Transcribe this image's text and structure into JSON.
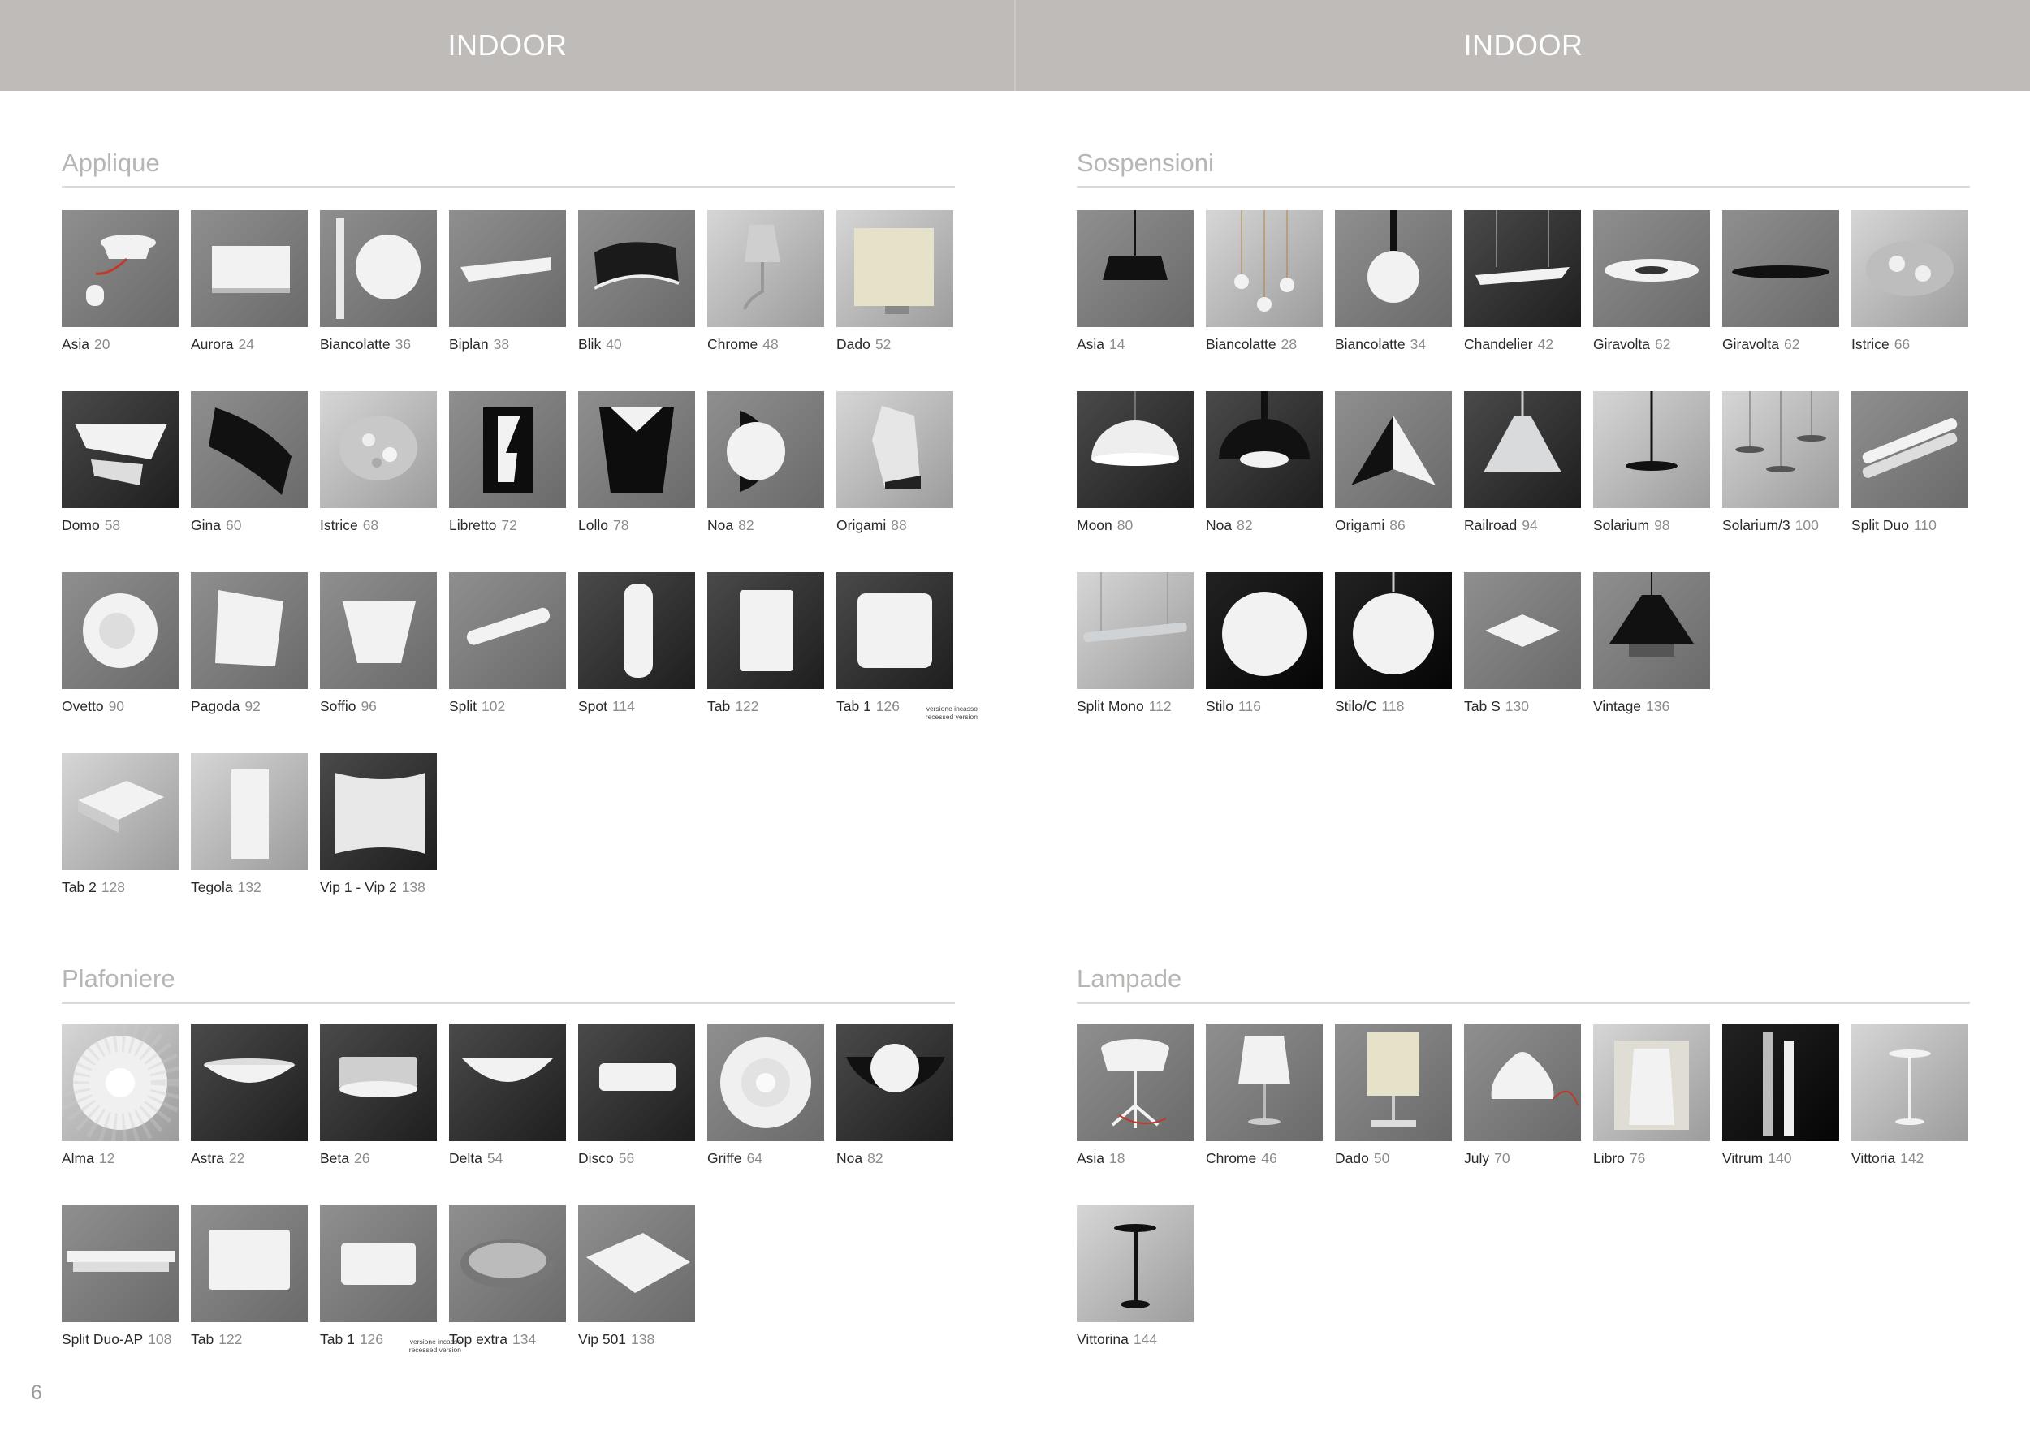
{
  "header": {
    "left_title": "INDOOR",
    "right_title": "INDOOR"
  },
  "page_number": "6",
  "sections": {
    "applique": {
      "title": "Applique",
      "items": [
        {
          "name": "Asia",
          "page": "20",
          "icon": "wall-lamp-red-arm"
        },
        {
          "name": "Aurora",
          "page": "24",
          "icon": "wall-panel-black"
        },
        {
          "name": "Biancolatte",
          "page": "36",
          "icon": "wall-globe"
        },
        {
          "name": "Biplan",
          "page": "38",
          "icon": "wall-bar"
        },
        {
          "name": "Blik",
          "page": "40",
          "icon": "wall-wave-black"
        },
        {
          "name": "Chrome",
          "page": "48",
          "icon": "wall-chrome-shade"
        },
        {
          "name": "Dado",
          "page": "52",
          "icon": "wall-fabric-cube"
        },
        {
          "name": "Domo",
          "page": "58",
          "icon": "wall-dome-box"
        },
        {
          "name": "Gina",
          "page": "60",
          "icon": "wall-black-fold"
        },
        {
          "name": "Istrice",
          "page": "68",
          "icon": "wall-crystal"
        },
        {
          "name": "Libretto",
          "page": "72",
          "icon": "wall-book-black"
        },
        {
          "name": "Lollo",
          "page": "78",
          "icon": "wall-cone-black"
        },
        {
          "name": "Noa",
          "page": "82",
          "icon": "wall-half-bowl"
        },
        {
          "name": "Origami",
          "page": "88",
          "icon": "wall-origami"
        },
        {
          "name": "Ovetto",
          "page": "90",
          "icon": "wall-round-shell"
        },
        {
          "name": "Pagoda",
          "page": "92",
          "icon": "wall-pagoda"
        },
        {
          "name": "Soffio",
          "page": "96",
          "icon": "wall-cone-white"
        },
        {
          "name": "Split",
          "page": "102",
          "icon": "wall-tube"
        },
        {
          "name": "Spot",
          "page": "114",
          "icon": "wall-cylinder"
        },
        {
          "name": "Tab",
          "page": "122",
          "icon": "wall-square-tall"
        },
        {
          "name": "Tab 1",
          "page": "126",
          "icon": "wall-recessed-square",
          "note_it": "versione incasso",
          "note_en": "recessed version"
        },
        {
          "name": "Tab 2",
          "page": "128",
          "icon": "wall-square-box"
        },
        {
          "name": "Tegola",
          "page": "132",
          "icon": "wall-tile"
        },
        {
          "name": "Vip 1 - Vip 2",
          "page": "138",
          "icon": "wall-curved-panel"
        }
      ]
    },
    "sospensioni": {
      "title": "Sospensioni",
      "items": [
        {
          "name": "Asia",
          "page": "14",
          "icon": "pendant-drum-black"
        },
        {
          "name": "Biancolatte",
          "page": "28",
          "icon": "pendant-multi-globes"
        },
        {
          "name": "Biancolatte",
          "page": "34",
          "icon": "pendant-globe"
        },
        {
          "name": "Chandelier",
          "page": "42",
          "icon": "pendant-chandelier"
        },
        {
          "name": "Giravolta",
          "page": "62",
          "icon": "pendant-ring"
        },
        {
          "name": "Giravolta",
          "page": "62",
          "icon": "pendant-disc"
        },
        {
          "name": "Istrice",
          "page": "66",
          "icon": "pendant-crystal"
        },
        {
          "name": "Moon",
          "page": "80",
          "icon": "pendant-dome-white"
        },
        {
          "name": "Noa",
          "page": "82",
          "icon": "pendant-dome-black"
        },
        {
          "name": "Origami",
          "page": "86",
          "icon": "pendant-origami"
        },
        {
          "name": "Railroad",
          "page": "94",
          "icon": "pendant-railroad"
        },
        {
          "name": "Solarium",
          "page": "98",
          "icon": "pendant-solarium"
        },
        {
          "name": "Solarium/3",
          "page": "100",
          "icon": "pendant-solarium-three"
        },
        {
          "name": "Split Duo",
          "page": "110",
          "icon": "pendant-double-tube"
        },
        {
          "name": "Split Mono",
          "page": "112",
          "icon": "pendant-single-tube"
        },
        {
          "name": "Stilo",
          "page": "116",
          "icon": "pendant-globe-large"
        },
        {
          "name": "Stilo/C",
          "page": "118",
          "icon": "pendant-globe-chain"
        },
        {
          "name": "Tab S",
          "page": "130",
          "icon": "pendant-square"
        },
        {
          "name": "Vintage",
          "page": "136",
          "icon": "pendant-cage-black"
        }
      ]
    },
    "plafoniere": {
      "title": "Plafoniere",
      "items": [
        {
          "name": "Alma",
          "page": "12",
          "icon": "ceiling-petals"
        },
        {
          "name": "Astra",
          "page": "22",
          "icon": "ceiling-dome-dark"
        },
        {
          "name": "Beta",
          "page": "26",
          "icon": "ceiling-drum-chrome"
        },
        {
          "name": "Delta",
          "page": "54",
          "icon": "ceiling-bowl-dark"
        },
        {
          "name": "Disco",
          "page": "56",
          "icon": "ceiling-disc"
        },
        {
          "name": "Griffe",
          "page": "64",
          "icon": "ceiling-swirl"
        },
        {
          "name": "Noa",
          "page": "82",
          "icon": "ceiling-half-bowl"
        },
        {
          "name": "Split Duo-AP",
          "page": "108",
          "icon": "ceiling-double-bar"
        },
        {
          "name": "Tab",
          "page": "122",
          "icon": "ceiling-square"
        },
        {
          "name": "Tab 1",
          "page": "126",
          "icon": "ceiling-square-flat",
          "note_it": "versione incasso",
          "note_en": "recessed version"
        },
        {
          "name": "Top extra",
          "page": "134",
          "icon": "ceiling-round-grey"
        },
        {
          "name": "Vip 501",
          "page": "138",
          "icon": "ceiling-curved-square"
        }
      ]
    },
    "lampade": {
      "title": "Lampade",
      "items": [
        {
          "name": "Asia",
          "page": "18",
          "icon": "table-tripod"
        },
        {
          "name": "Chrome",
          "page": "46",
          "icon": "table-shade-chrome"
        },
        {
          "name": "Dado",
          "page": "50",
          "icon": "table-fabric-cube"
        },
        {
          "name": "July",
          "page": "70",
          "icon": "table-bell"
        },
        {
          "name": "Libro",
          "page": "76",
          "icon": "table-book"
        },
        {
          "name": "Vitrum",
          "page": "140",
          "icon": "floor-glass-columns"
        },
        {
          "name": "Vittoria",
          "page": "142",
          "icon": "table-slim"
        },
        {
          "name": "Vittorina",
          "page": "144",
          "icon": "table-slim-black"
        }
      ]
    }
  },
  "colors": {
    "header_band": "#bebbb9",
    "section_title": "#b8b6b4",
    "name_text": "#2a2a2a",
    "page_text": "#8c8c8c"
  }
}
